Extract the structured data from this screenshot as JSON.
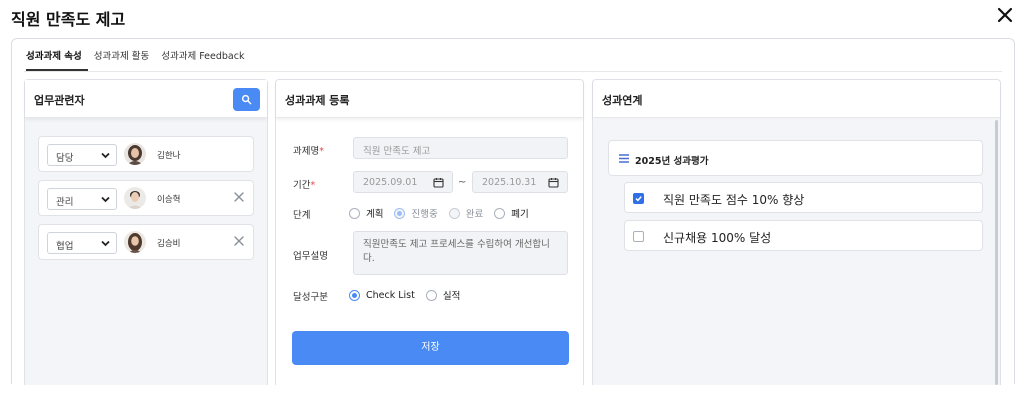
{
  "dialog": {
    "title": "직원 만족도 제고"
  },
  "tabs": [
    {
      "label": "성과과제 속성",
      "active": true
    },
    {
      "label": "성과과제 활동",
      "active": false
    },
    {
      "label": "성과과제 Feedback",
      "active": false
    }
  ],
  "stakeholders": {
    "title": "업무관련자",
    "people": [
      {
        "role": "담당",
        "name": "김한나",
        "removable": false
      },
      {
        "role": "관리",
        "name": "이승혁",
        "removable": true
      },
      {
        "role": "협업",
        "name": "김승비",
        "removable": true
      }
    ]
  },
  "task_form": {
    "title": "성과과제 등록",
    "name_label": "과제명",
    "name_value": "직원 만족도 제고",
    "period_label": "기간",
    "start_date": "2025.09.01",
    "end_date": "2025.10.31",
    "period_separator": "~",
    "stage_label": "단계",
    "stages": [
      {
        "label": "계획",
        "selected": false,
        "disabled": false
      },
      {
        "label": "진행중",
        "selected": true,
        "disabled": true
      },
      {
        "label": "완료",
        "selected": false,
        "disabled": true
      },
      {
        "label": "폐기",
        "selected": false,
        "disabled": false
      }
    ],
    "desc_label": "업무설명",
    "desc_value": "직원만족도 제고 프로세스를 수립하여 개선합니다.",
    "type_label": "달성구분",
    "types": [
      {
        "label": "Check List",
        "selected": true
      },
      {
        "label": "실적",
        "selected": false
      }
    ],
    "save_label": "저장"
  },
  "link": {
    "title": "성과연계",
    "group_title": "2025년 성과평가",
    "goals": [
      {
        "text": "직원 만족도 점수 10% 향상",
        "checked": true
      },
      {
        "text": "신규채용 100% 달성",
        "checked": false
      }
    ]
  },
  "colors": {
    "primary": "#4a8af4",
    "required": "#e5484d"
  }
}
